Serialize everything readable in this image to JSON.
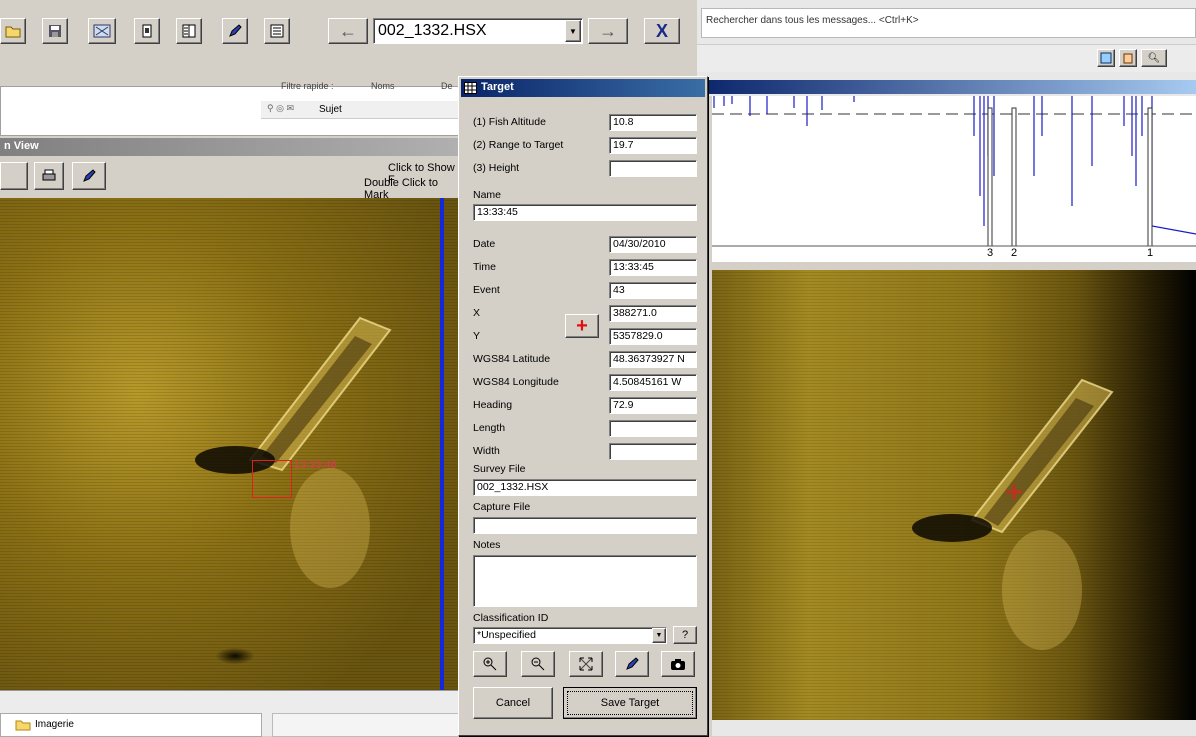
{
  "toolbar": {
    "file_combo_value": "002_1332.HSX"
  },
  "mail": {
    "search_placeholder": "Rechercher dans tous les messages... <Ctrl+K>",
    "filter_label": "Filtre rapide :",
    "col_names": "Noms",
    "col_from": "De",
    "col_subject": "Sujet",
    "folder_label": "Imagerie"
  },
  "left_view": {
    "title": "n View",
    "hint_line1": "Click to Show F",
    "hint_line2": "Double Click to Mark",
    "target_label": "13:33:46"
  },
  "profile": {
    "marker1": "3",
    "marker2": "2",
    "marker3": "1"
  },
  "dialog": {
    "title": "Target",
    "fish_altitude_label": "(1) Fish Altitude",
    "fish_altitude_value": "10.8",
    "range_label": "(2) Range to Target",
    "range_value": "19.7",
    "height_label": "(3) Height",
    "height_value": "",
    "name_label": "Name",
    "name_value": "13:33:45",
    "date_label": "Date",
    "date_value": "04/30/2010",
    "time_label": "Time",
    "time_value": "13:33:45",
    "event_label": "Event",
    "event_value": "43",
    "x_label": "X",
    "x_value": "388271.0",
    "y_label": "Y",
    "y_value": "5357829.0",
    "lat_label": "WGS84 Latitude",
    "lat_value": "48.36373927 N",
    "lon_label": "WGS84 Longitude",
    "lon_value": "4.50845161 W",
    "heading_label": "Heading",
    "heading_value": "72.9",
    "length_label": "Length",
    "length_value": "",
    "width_label": "Width",
    "width_value": "",
    "survey_label": "Survey File",
    "survey_value": "002_1332.HSX",
    "capture_label": "Capture File",
    "capture_value": "",
    "notes_label": "Notes",
    "notes_value": "",
    "class_label": "Classification ID",
    "class_value": "*Unspecified",
    "help_label": "?",
    "cancel_label": "Cancel",
    "save_label": "Save Target"
  }
}
